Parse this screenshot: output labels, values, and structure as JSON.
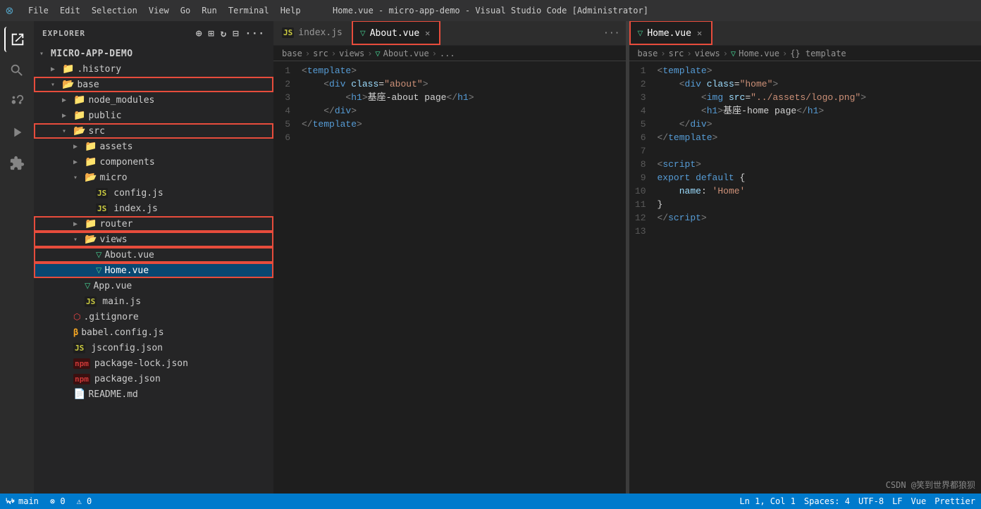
{
  "titlebar": {
    "title": "Home.vue - micro-app-demo - Visual Studio Code [Administrator]",
    "menus": [
      "File",
      "Edit",
      "Selection",
      "View",
      "Go",
      "Run",
      "Terminal",
      "Help"
    ]
  },
  "sidebar": {
    "header": "EXPLORER",
    "project": "MICRO-APP-DEMO",
    "tree": [
      {
        "id": "history",
        "label": ".history",
        "type": "folder",
        "indent": 1,
        "open": false
      },
      {
        "id": "base",
        "label": "base",
        "type": "folder-open",
        "indent": 1,
        "open": true,
        "highlighted": true
      },
      {
        "id": "node_modules",
        "label": "node_modules",
        "type": "folder",
        "indent": 2,
        "open": false
      },
      {
        "id": "public",
        "label": "public",
        "type": "folder",
        "indent": 2,
        "open": false
      },
      {
        "id": "src",
        "label": "src",
        "type": "folder-open",
        "indent": 2,
        "open": true,
        "highlighted": true
      },
      {
        "id": "assets",
        "label": "assets",
        "type": "folder",
        "indent": 3,
        "open": false
      },
      {
        "id": "components",
        "label": "components",
        "type": "folder",
        "indent": 3,
        "open": false
      },
      {
        "id": "micro",
        "label": "micro",
        "type": "folder-open",
        "indent": 3,
        "open": true
      },
      {
        "id": "config",
        "label": "config.js",
        "type": "js",
        "indent": 4
      },
      {
        "id": "index_micro",
        "label": "index.js",
        "type": "js",
        "indent": 4
      },
      {
        "id": "router",
        "label": "router",
        "type": "folder",
        "indent": 3,
        "open": false,
        "highlighted": true
      },
      {
        "id": "views",
        "label": "views",
        "type": "folder-open",
        "indent": 3,
        "open": true,
        "highlighted": true
      },
      {
        "id": "about_vue",
        "label": "About.vue",
        "type": "vue",
        "indent": 4,
        "highlighted": true
      },
      {
        "id": "home_vue",
        "label": "Home.vue",
        "type": "vue",
        "indent": 4,
        "selected": true,
        "highlighted": true
      },
      {
        "id": "app_vue",
        "label": "App.vue",
        "type": "vue",
        "indent": 3
      },
      {
        "id": "main_js",
        "label": "main.js",
        "type": "js",
        "indent": 3
      },
      {
        "id": "gitignore",
        "label": ".gitignore",
        "type": "git",
        "indent": 2
      },
      {
        "id": "babel_config",
        "label": "babel.config.js",
        "type": "babel",
        "indent": 2
      },
      {
        "id": "jsconfig",
        "label": "jsconfig.json",
        "type": "js",
        "indent": 2
      },
      {
        "id": "package_lock",
        "label": "package-lock.json",
        "type": "npm",
        "indent": 2
      },
      {
        "id": "package_json",
        "label": "package.json",
        "type": "npm",
        "indent": 2
      },
      {
        "id": "readme",
        "label": "README.md",
        "type": "md",
        "indent": 2
      }
    ]
  },
  "left_editor": {
    "tabs": [
      {
        "id": "index_js_tab",
        "label": "index.js",
        "type": "js",
        "active": false
      },
      {
        "id": "about_vue_tab",
        "label": "About.vue",
        "type": "vue",
        "active": true,
        "highlighted": true
      }
    ],
    "breadcrumb": [
      "base",
      "src",
      "views",
      "About.vue",
      "..."
    ],
    "code": [
      {
        "line": 1,
        "tokens": [
          {
            "t": "t-bracket",
            "v": "<"
          },
          {
            "t": "t-tag",
            "v": "template"
          },
          {
            "t": "t-bracket",
            "v": ">"
          }
        ]
      },
      {
        "line": 2,
        "tokens": [
          {
            "t": "t-plain",
            "v": "    "
          },
          {
            "t": "t-bracket",
            "v": "<"
          },
          {
            "t": "t-tag",
            "v": "div"
          },
          {
            "t": "t-plain",
            "v": " "
          },
          {
            "t": "t-attr",
            "v": "class"
          },
          {
            "t": "t-plain",
            "v": "="
          },
          {
            "t": "t-string",
            "v": "\"about\""
          },
          {
            "t": "t-bracket",
            "v": ">"
          }
        ]
      },
      {
        "line": 3,
        "tokens": [
          {
            "t": "t-plain",
            "v": "        "
          },
          {
            "t": "t-bracket",
            "v": "<"
          },
          {
            "t": "t-tag",
            "v": "h1"
          },
          {
            "t": "t-bracket",
            "v": ">"
          },
          {
            "t": "t-chinese",
            "v": "基座"
          },
          {
            "t": "t-plain",
            "v": "-about page"
          },
          {
            "t": "t-bracket",
            "v": "</"
          },
          {
            "t": "t-tag",
            "v": "h1"
          },
          {
            "t": "t-bracket",
            "v": ">"
          }
        ]
      },
      {
        "line": 4,
        "tokens": [
          {
            "t": "t-plain",
            "v": "    "
          },
          {
            "t": "t-bracket",
            "v": "</"
          },
          {
            "t": "t-tag",
            "v": "div"
          },
          {
            "t": "t-bracket",
            "v": ">"
          }
        ]
      },
      {
        "line": 5,
        "tokens": [
          {
            "t": "t-bracket",
            "v": "</"
          },
          {
            "t": "t-tag",
            "v": "template"
          },
          {
            "t": "t-bracket",
            "v": ">"
          }
        ]
      },
      {
        "line": 6,
        "tokens": []
      }
    ]
  },
  "right_editor": {
    "tabs": [
      {
        "id": "home_vue_tab2",
        "label": "Home.vue",
        "type": "vue",
        "active": true,
        "highlighted": true,
        "closable": true
      }
    ],
    "breadcrumb": [
      "base",
      "src",
      "views",
      "Home.vue",
      "{} template"
    ],
    "code": [
      {
        "line": 1,
        "tokens": [
          {
            "t": "t-bracket",
            "v": "<"
          },
          {
            "t": "t-tag",
            "v": "template"
          },
          {
            "t": "t-bracket",
            "v": ">"
          }
        ]
      },
      {
        "line": 2,
        "tokens": [
          {
            "t": "t-plain",
            "v": "    "
          },
          {
            "t": "t-bracket",
            "v": "<"
          },
          {
            "t": "t-tag",
            "v": "div"
          },
          {
            "t": "t-plain",
            "v": " "
          },
          {
            "t": "t-attr",
            "v": "class"
          },
          {
            "t": "t-plain",
            "v": "="
          },
          {
            "t": "t-string",
            "v": "\"home\""
          },
          {
            "t": "t-bracket",
            "v": ">"
          }
        ]
      },
      {
        "line": 3,
        "tokens": [
          {
            "t": "t-plain",
            "v": "        "
          },
          {
            "t": "t-bracket",
            "v": "<"
          },
          {
            "t": "t-tag",
            "v": "img"
          },
          {
            "t": "t-plain",
            "v": " "
          },
          {
            "t": "t-attr",
            "v": "src"
          },
          {
            "t": "t-plain",
            "v": "="
          },
          {
            "t": "t-string",
            "v": "\"../assets/logo.png\""
          },
          {
            "t": "t-bracket",
            "v": ">"
          }
        ]
      },
      {
        "line": 4,
        "tokens": [
          {
            "t": "t-plain",
            "v": "        "
          },
          {
            "t": "t-bracket",
            "v": "<"
          },
          {
            "t": "t-tag",
            "v": "h1"
          },
          {
            "t": "t-bracket",
            "v": ">"
          },
          {
            "t": "t-chinese",
            "v": "基座"
          },
          {
            "t": "t-plain",
            "v": "-home page"
          },
          {
            "t": "t-bracket",
            "v": "</"
          },
          {
            "t": "t-tag",
            "v": "h1"
          },
          {
            "t": "t-bracket",
            "v": ">"
          }
        ]
      },
      {
        "line": 5,
        "tokens": [
          {
            "t": "t-plain",
            "v": "    "
          },
          {
            "t": "t-bracket",
            "v": "</"
          },
          {
            "t": "t-tag",
            "v": "div"
          },
          {
            "t": "t-bracket",
            "v": ">"
          }
        ]
      },
      {
        "line": 6,
        "tokens": [
          {
            "t": "t-bracket",
            "v": "</"
          },
          {
            "t": "t-tag",
            "v": "template"
          },
          {
            "t": "t-bracket",
            "v": ">"
          }
        ]
      },
      {
        "line": 7,
        "tokens": []
      },
      {
        "line": 8,
        "tokens": [
          {
            "t": "t-bracket",
            "v": "<"
          },
          {
            "t": "t-tag",
            "v": "script"
          },
          {
            "t": "t-bracket",
            "v": ">"
          }
        ]
      },
      {
        "line": 9,
        "tokens": [
          {
            "t": "t-keyword",
            "v": "export"
          },
          {
            "t": "t-plain",
            "v": " "
          },
          {
            "t": "t-keyword",
            "v": "default"
          },
          {
            "t": "t-plain",
            "v": " {"
          }
        ]
      },
      {
        "line": 10,
        "tokens": [
          {
            "t": "t-plain",
            "v": "    "
          },
          {
            "t": "t-prop",
            "v": "name"
          },
          {
            "t": "t-plain",
            "v": ": "
          },
          {
            "t": "t-string",
            "v": "'Home'"
          }
        ]
      },
      {
        "line": 11,
        "tokens": [
          {
            "t": "t-plain",
            "v": "}"
          }
        ]
      },
      {
        "line": 12,
        "tokens": [
          {
            "t": "t-bracket",
            "v": "</"
          },
          {
            "t": "t-tag",
            "v": "script"
          },
          {
            "t": "t-bracket",
            "v": ">"
          }
        ]
      },
      {
        "line": 13,
        "tokens": []
      }
    ]
  },
  "status_bar": {
    "branch": "main",
    "errors": "0",
    "warnings": "0",
    "ln": "Ln 1, Col 1",
    "spaces": "Spaces: 4",
    "encoding": "UTF-8",
    "eol": "LF",
    "language": "Vue",
    "format": "Prettier"
  },
  "watermark": "CSDN @笑到世界都狼狈"
}
